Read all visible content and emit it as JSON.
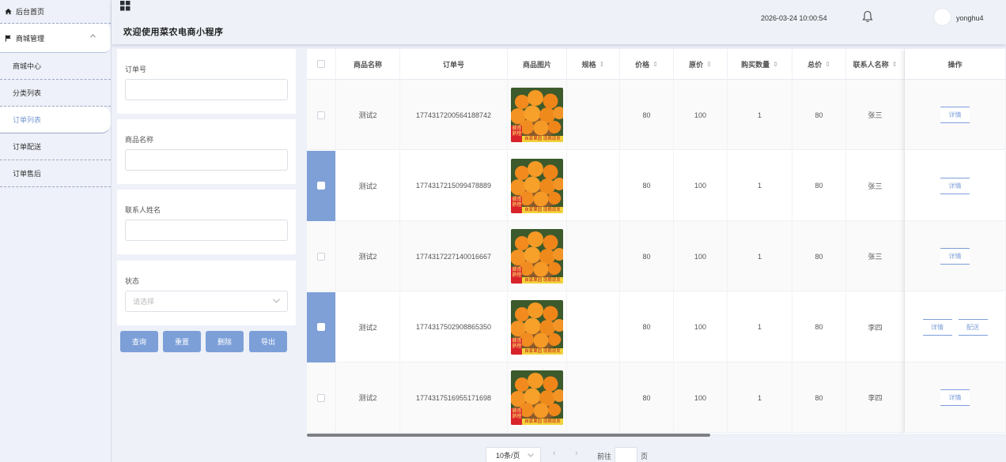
{
  "sidebar": {
    "home": {
      "label": "后台首页",
      "icon": "home-icon"
    },
    "group": {
      "label": "商城管理",
      "icon": "flag-icon"
    },
    "items": [
      {
        "label": "商城中心"
      },
      {
        "label": "分类列表"
      },
      {
        "label": "订单列表"
      },
      {
        "label": "订单配送"
      },
      {
        "label": "订单售后"
      }
    ]
  },
  "header": {
    "welcome": "欢迎使用菜农电商小程序",
    "datetime": "2026-03-24 10:00:54",
    "username": "yonghu4"
  },
  "search": {
    "order_label": "订单号",
    "product_label": "商品名称",
    "contact_label": "联系人姓名",
    "status_label": "状态",
    "status_placeholder": "请选择",
    "buttons": {
      "query": "查询",
      "reset": "重置",
      "delete": "删除",
      "export": "导出"
    }
  },
  "table": {
    "headers": [
      "商品名称",
      "订单号",
      "商品图片",
      "规格",
      "价格",
      "原价",
      "购买数量",
      "总价",
      "联系人名称",
      "操作"
    ],
    "sort_icon": "⇕",
    "image_caption": {
      "left": "赣南",
      "middle": "脐橙",
      "banner": "自家果园 现摘现发"
    },
    "rows": [
      {
        "name": "测试2",
        "order": "1774317200564188742",
        "spec": "",
        "price": "80",
        "orig": "100",
        "qty": "1",
        "total": "80",
        "contact": "张三",
        "selected": false,
        "actions": [
          "详情"
        ]
      },
      {
        "name": "测试2",
        "order": "1774317215099478889",
        "spec": "",
        "price": "80",
        "orig": "100",
        "qty": "1",
        "total": "80",
        "contact": "张三",
        "selected": true,
        "actions": [
          "详情"
        ]
      },
      {
        "name": "测试2",
        "order": "1774317227140016667",
        "spec": "",
        "price": "80",
        "orig": "100",
        "qty": "1",
        "total": "80",
        "contact": "张三",
        "selected": false,
        "actions": [
          "详情"
        ]
      },
      {
        "name": "测试2",
        "order": "1774317502908865350",
        "spec": "",
        "price": "80",
        "orig": "100",
        "qty": "1",
        "total": "80",
        "contact": "李四",
        "selected": true,
        "actions": [
          "详情",
          "配送"
        ]
      },
      {
        "name": "测试2",
        "order": "1774317516955171698",
        "spec": "",
        "price": "80",
        "orig": "100",
        "qty": "1",
        "total": "80",
        "contact": "李四",
        "selected": false,
        "actions": [
          "详情"
        ]
      }
    ]
  },
  "pagination": {
    "page_size": "10条/页",
    "goto_label": "前往",
    "page_suffix": "页",
    "prev": "‹",
    "next": "›"
  }
}
